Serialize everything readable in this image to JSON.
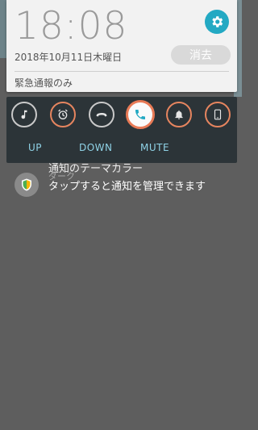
{
  "status": {
    "time": "18:08",
    "date": "2018年10月11日木曜日",
    "clear_label": "消去",
    "mode_text": "緊急通報のみ"
  },
  "sound_panel": {
    "buttons": [
      {
        "icon": "music-note-icon",
        "ring": "gray"
      },
      {
        "icon": "alarm-clock-icon",
        "ring": "orange"
      },
      {
        "icon": "call-end-icon",
        "ring": "gray"
      },
      {
        "icon": "phone-icon",
        "ring": "orange",
        "active": true
      },
      {
        "icon": "bell-icon",
        "ring": "orange"
      },
      {
        "icon": "smartphone-icon",
        "ring": "orange"
      }
    ],
    "labels": {
      "up": "UP",
      "down": "DOWN",
      "mute": "MUTE"
    }
  },
  "notification": {
    "title": "通知のテーマカラー",
    "subtitle": "ダーク",
    "body": "タップすると通知を管理できます",
    "icon": "shield-icon"
  },
  "colors": {
    "accent": "#23a9c3",
    "active_ring": "#e87a56",
    "label": "#8fd2e6"
  }
}
